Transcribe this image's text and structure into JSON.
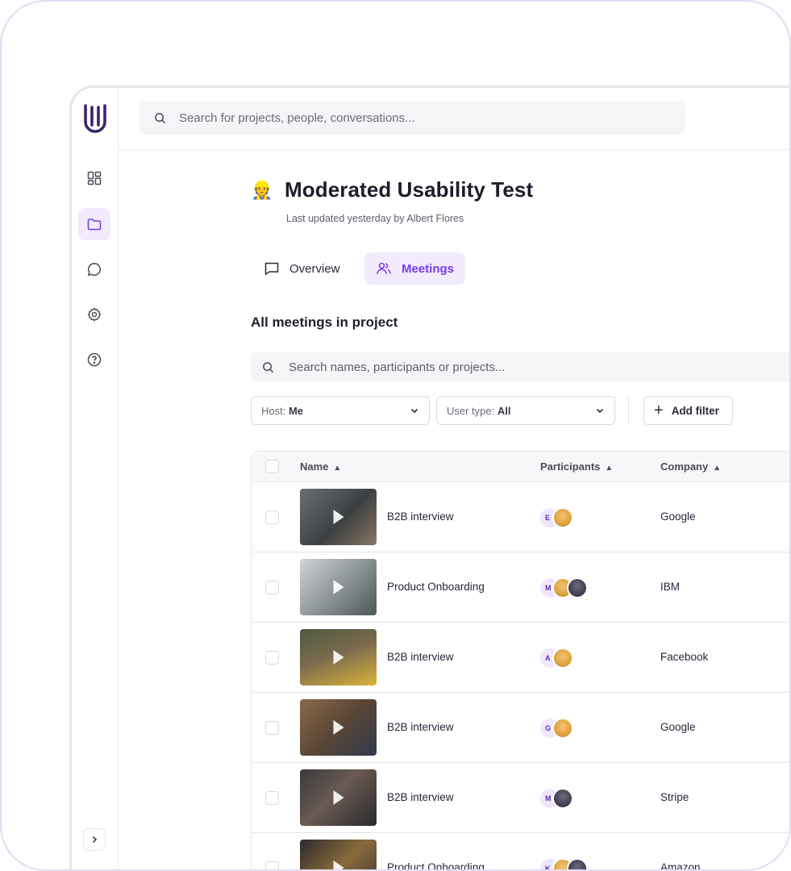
{
  "app": {
    "search_placeholder": "Search for projects, people, conversations..."
  },
  "sidebar": {
    "items": [
      {
        "name": "dashboard",
        "icon": "dashboard-icon",
        "active": false
      },
      {
        "name": "projects",
        "icon": "folder-icon",
        "active": true
      },
      {
        "name": "conversations",
        "icon": "chat-icon",
        "active": false
      },
      {
        "name": "settings",
        "icon": "gear-icon",
        "active": false
      },
      {
        "name": "help",
        "icon": "help-icon",
        "active": false
      }
    ],
    "expand_icon": "chevron-right-icon"
  },
  "project": {
    "emoji": "👷",
    "title": "Moderated Usability Test",
    "subtitle": "Last updated yesterday by Albert Flores"
  },
  "tabs": {
    "overview": "Overview",
    "meetings": "Meetings"
  },
  "section_title": "All meetings in project",
  "table_search_placeholder": "Search names, participants or projects...",
  "filters": {
    "host_label": "Host:",
    "host_value": "Me",
    "user_type_label": "User type:",
    "user_type_value": "All",
    "add_filter": "Add filter"
  },
  "table": {
    "columns": {
      "name": "Name",
      "participants": "Participants",
      "company": "Company"
    },
    "rows": [
      {
        "name": "B2B interview",
        "initial": "E",
        "company": "Google"
      },
      {
        "name": "Product Onboarding",
        "initial": "M",
        "company": "IBM"
      },
      {
        "name": "B2B interview",
        "initial": "A",
        "company": "Facebook"
      },
      {
        "name": "B2B interview",
        "initial": "G",
        "company": "Google"
      },
      {
        "name": "B2B interview",
        "initial": "M",
        "company": "Stripe"
      },
      {
        "name": "Product Onboarding",
        "initial": "K",
        "company": "Amazon"
      }
    ]
  },
  "colors": {
    "accent": "#7c3aed",
    "accent_bg": "#f1ebfd",
    "border": "#e6e6ea"
  }
}
